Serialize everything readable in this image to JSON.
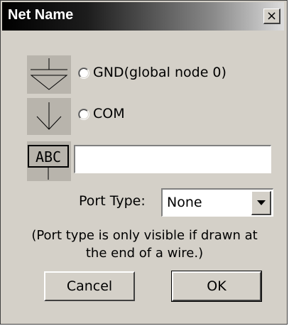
{
  "window": {
    "title": "Net Name",
    "close_glyph": "×"
  },
  "options": {
    "gnd_label": "GND(global node 0)",
    "com_label": "COM",
    "label_icon_text": "ABC",
    "custom_name_value": ""
  },
  "port_type": {
    "label": "Port Type:",
    "selected": "None"
  },
  "note": {
    "line1": "(Port type is only visible if drawn at",
    "line2": "the end of a wire.)"
  },
  "buttons": {
    "cancel": "Cancel",
    "ok": "OK"
  },
  "icons": {
    "gnd": "ground-symbol-icon",
    "com": "common-symbol-icon",
    "label": "net-label-icon"
  }
}
